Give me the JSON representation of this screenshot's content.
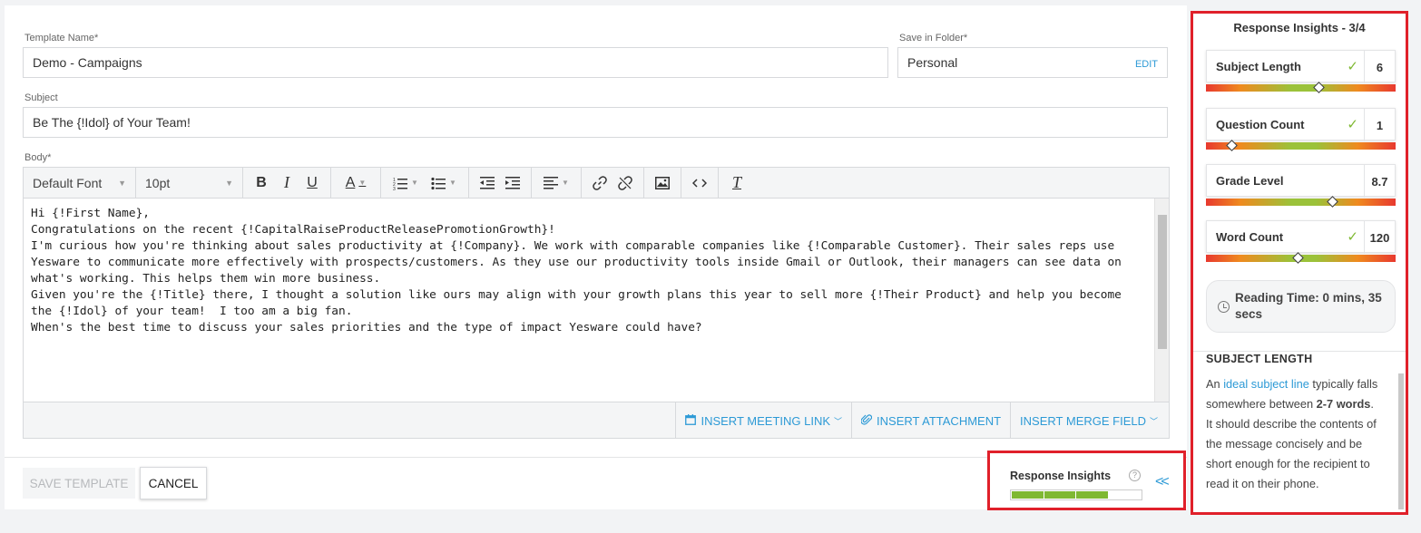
{
  "form": {
    "template_name_label": "Template Name*",
    "template_name_value": "Demo - Campaigns",
    "folder_label": "Save in Folder*",
    "folder_value": "Personal",
    "folder_edit": "EDIT",
    "subject_label": "Subject",
    "subject_value": "Be The {!Idol} of Your Team!",
    "body_label": "Body*"
  },
  "toolbar": {
    "font": "Default Font",
    "size": "10pt",
    "bold": "B",
    "italic": "I",
    "underline": "U",
    "font_color": "A",
    "clear_format": "T"
  },
  "body_lines": [
    "Hi {!First Name},",
    "",
    "Congratulations on the recent {!CapitalRaiseProductReleasePromotionGrowth}!",
    "",
    "I'm curious how you're thinking about sales productivity at {!Company}. We work with comparable companies like {!Comparable Customer}. Their sales reps use Yesware to communicate more effectively with prospects/customers. As they use our productivity tools inside Gmail or Outlook, their managers can see data on what's working. This helps them win more business.",
    "",
    "Given you're the {!Title} there, I thought a solution like ours may align with your growth plans this year to sell more {!Their Product} and help you become the {!Idol} of your team!  I too am a big fan.",
    "",
    "When's the best time to discuss your sales priorities and the type of impact Yesware could have?"
  ],
  "insert_bar": {
    "meeting": "INSERT MEETING LINK",
    "attachment": "INSERT ATTACHMENT",
    "merge": "INSERT MERGE FIELD"
  },
  "footer": {
    "save": "SAVE TEMPLATE",
    "cancel": "CANCEL",
    "insights_label": "Response Insights",
    "insights_progress": 0.75,
    "collapse": "<<"
  },
  "panel": {
    "title": "Response Insights - 3/4",
    "metrics": [
      {
        "name": "Subject Length",
        "value": "6",
        "passed": true,
        "marker": 0.6
      },
      {
        "name": "Question Count",
        "value": "1",
        "passed": true,
        "marker": 0.14
      },
      {
        "name": "Grade Level",
        "value": "8.7",
        "passed": false,
        "marker": 0.67
      },
      {
        "name": "Word Count",
        "value": "120",
        "passed": true,
        "marker": 0.49
      }
    ],
    "reading_time": "Reading Time: 0 mins, 35 secs",
    "section_heading": "SUBJECT LENGTH",
    "desc_an": "An ",
    "desc_link": "ideal subject line",
    "desc_mid": " typically falls somewhere between ",
    "desc_bold": "2-7 words",
    "desc_rest": ". It should describe the contents of the message concisely and be short enough for the recipient to read it on their phone."
  },
  "colors": {
    "accent_blue": "#2d9ad6",
    "highlight_red": "#e0202a",
    "success_green": "#7fb832"
  }
}
